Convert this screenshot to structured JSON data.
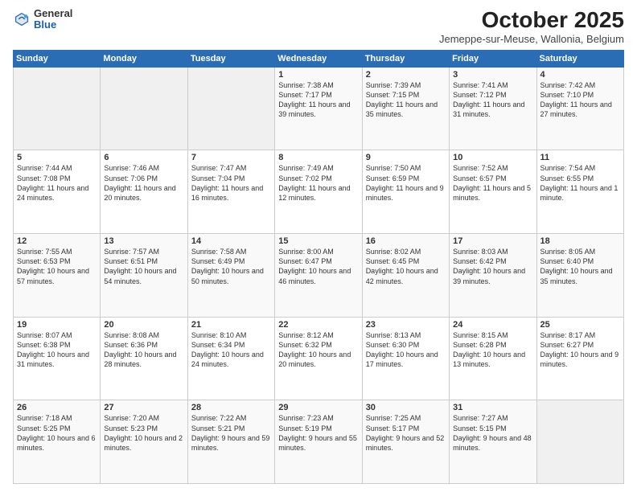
{
  "logo": {
    "general": "General",
    "blue": "Blue"
  },
  "header": {
    "month": "October 2025",
    "location": "Jemeppe-sur-Meuse, Wallonia, Belgium"
  },
  "days_of_week": [
    "Sunday",
    "Monday",
    "Tuesday",
    "Wednesday",
    "Thursday",
    "Friday",
    "Saturday"
  ],
  "weeks": [
    [
      {
        "day": "",
        "content": ""
      },
      {
        "day": "",
        "content": ""
      },
      {
        "day": "",
        "content": ""
      },
      {
        "day": "1",
        "content": "Sunrise: 7:38 AM\nSunset: 7:17 PM\nDaylight: 11 hours and 39 minutes."
      },
      {
        "day": "2",
        "content": "Sunrise: 7:39 AM\nSunset: 7:15 PM\nDaylight: 11 hours and 35 minutes."
      },
      {
        "day": "3",
        "content": "Sunrise: 7:41 AM\nSunset: 7:12 PM\nDaylight: 11 hours and 31 minutes."
      },
      {
        "day": "4",
        "content": "Sunrise: 7:42 AM\nSunset: 7:10 PM\nDaylight: 11 hours and 27 minutes."
      }
    ],
    [
      {
        "day": "5",
        "content": "Sunrise: 7:44 AM\nSunset: 7:08 PM\nDaylight: 11 hours and 24 minutes."
      },
      {
        "day": "6",
        "content": "Sunrise: 7:46 AM\nSunset: 7:06 PM\nDaylight: 11 hours and 20 minutes."
      },
      {
        "day": "7",
        "content": "Sunrise: 7:47 AM\nSunset: 7:04 PM\nDaylight: 11 hours and 16 minutes."
      },
      {
        "day": "8",
        "content": "Sunrise: 7:49 AM\nSunset: 7:02 PM\nDaylight: 11 hours and 12 minutes."
      },
      {
        "day": "9",
        "content": "Sunrise: 7:50 AM\nSunset: 6:59 PM\nDaylight: 11 hours and 9 minutes."
      },
      {
        "day": "10",
        "content": "Sunrise: 7:52 AM\nSunset: 6:57 PM\nDaylight: 11 hours and 5 minutes."
      },
      {
        "day": "11",
        "content": "Sunrise: 7:54 AM\nSunset: 6:55 PM\nDaylight: 11 hours and 1 minute."
      }
    ],
    [
      {
        "day": "12",
        "content": "Sunrise: 7:55 AM\nSunset: 6:53 PM\nDaylight: 10 hours and 57 minutes."
      },
      {
        "day": "13",
        "content": "Sunrise: 7:57 AM\nSunset: 6:51 PM\nDaylight: 10 hours and 54 minutes."
      },
      {
        "day": "14",
        "content": "Sunrise: 7:58 AM\nSunset: 6:49 PM\nDaylight: 10 hours and 50 minutes."
      },
      {
        "day": "15",
        "content": "Sunrise: 8:00 AM\nSunset: 6:47 PM\nDaylight: 10 hours and 46 minutes."
      },
      {
        "day": "16",
        "content": "Sunrise: 8:02 AM\nSunset: 6:45 PM\nDaylight: 10 hours and 42 minutes."
      },
      {
        "day": "17",
        "content": "Sunrise: 8:03 AM\nSunset: 6:42 PM\nDaylight: 10 hours and 39 minutes."
      },
      {
        "day": "18",
        "content": "Sunrise: 8:05 AM\nSunset: 6:40 PM\nDaylight: 10 hours and 35 minutes."
      }
    ],
    [
      {
        "day": "19",
        "content": "Sunrise: 8:07 AM\nSunset: 6:38 PM\nDaylight: 10 hours and 31 minutes."
      },
      {
        "day": "20",
        "content": "Sunrise: 8:08 AM\nSunset: 6:36 PM\nDaylight: 10 hours and 28 minutes."
      },
      {
        "day": "21",
        "content": "Sunrise: 8:10 AM\nSunset: 6:34 PM\nDaylight: 10 hours and 24 minutes."
      },
      {
        "day": "22",
        "content": "Sunrise: 8:12 AM\nSunset: 6:32 PM\nDaylight: 10 hours and 20 minutes."
      },
      {
        "day": "23",
        "content": "Sunrise: 8:13 AM\nSunset: 6:30 PM\nDaylight: 10 hours and 17 minutes."
      },
      {
        "day": "24",
        "content": "Sunrise: 8:15 AM\nSunset: 6:28 PM\nDaylight: 10 hours and 13 minutes."
      },
      {
        "day": "25",
        "content": "Sunrise: 8:17 AM\nSunset: 6:27 PM\nDaylight: 10 hours and 9 minutes."
      }
    ],
    [
      {
        "day": "26",
        "content": "Sunrise: 7:18 AM\nSunset: 5:25 PM\nDaylight: 10 hours and 6 minutes."
      },
      {
        "day": "27",
        "content": "Sunrise: 7:20 AM\nSunset: 5:23 PM\nDaylight: 10 hours and 2 minutes."
      },
      {
        "day": "28",
        "content": "Sunrise: 7:22 AM\nSunset: 5:21 PM\nDaylight: 9 hours and 59 minutes."
      },
      {
        "day": "29",
        "content": "Sunrise: 7:23 AM\nSunset: 5:19 PM\nDaylight: 9 hours and 55 minutes."
      },
      {
        "day": "30",
        "content": "Sunrise: 7:25 AM\nSunset: 5:17 PM\nDaylight: 9 hours and 52 minutes."
      },
      {
        "day": "31",
        "content": "Sunrise: 7:27 AM\nSunset: 5:15 PM\nDaylight: 9 hours and 48 minutes."
      },
      {
        "day": "",
        "content": ""
      }
    ]
  ]
}
